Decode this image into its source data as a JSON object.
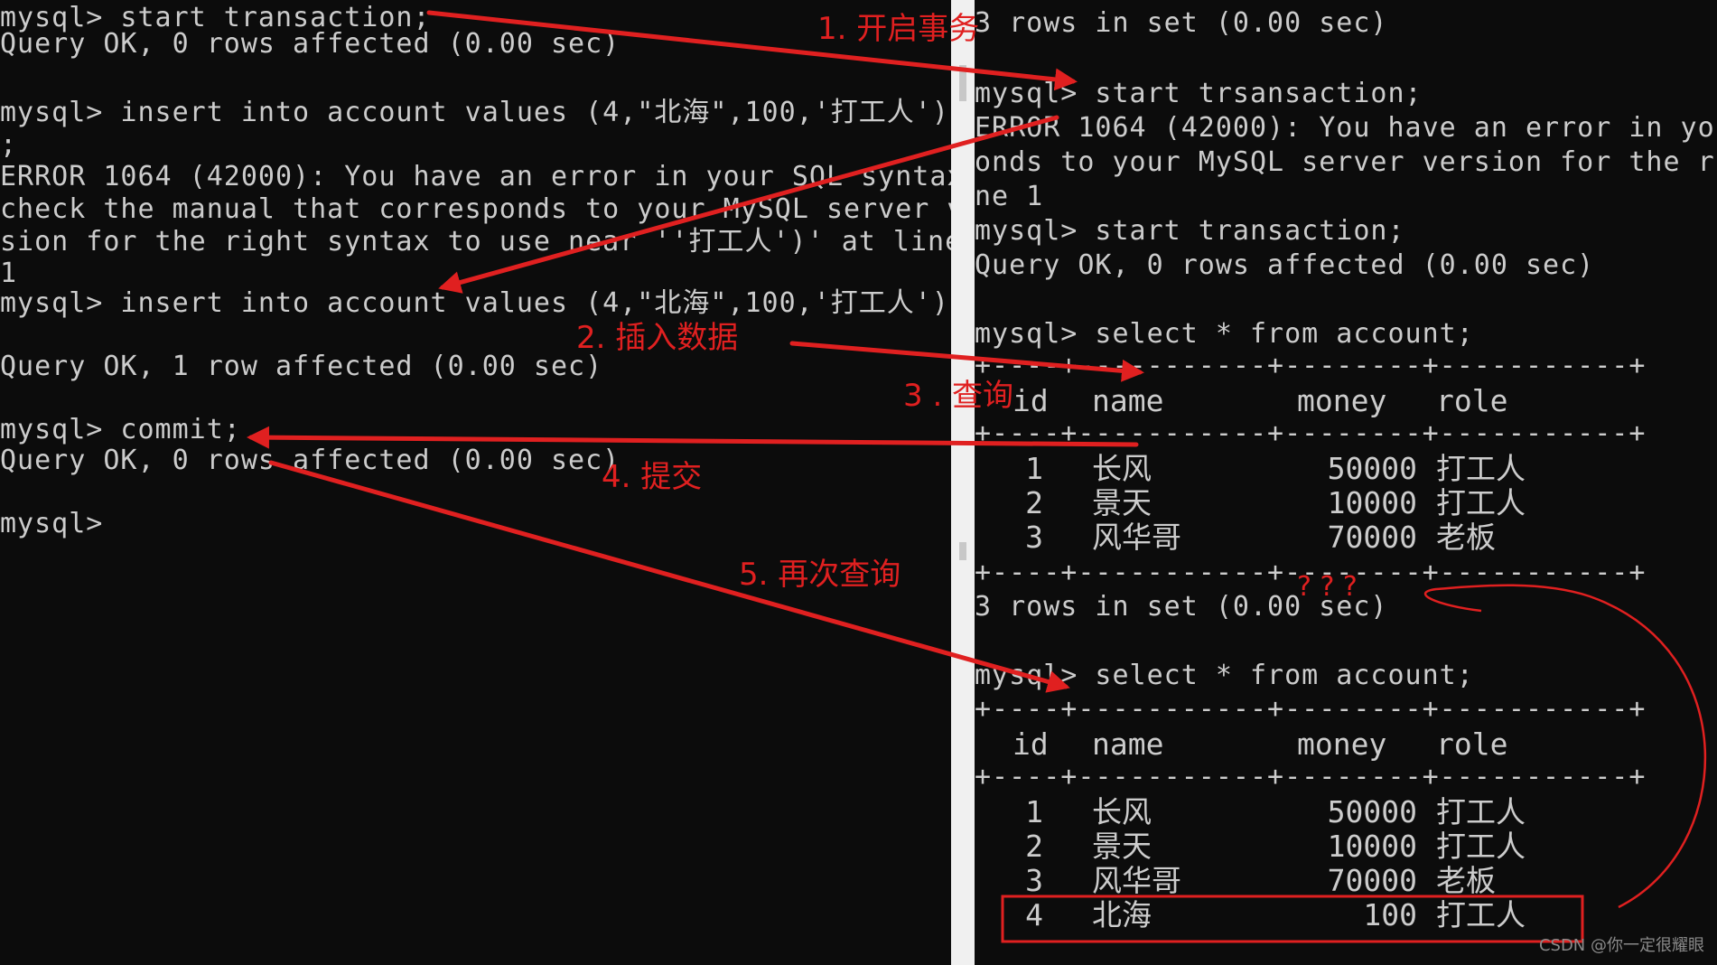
{
  "left_terminal": {
    "lines": [
      "mysql> start transaction;",
      "Query OK, 0 rows affected (0.00 sec)",
      "",
      "mysql> insert into account values (4,\"北海\",100,'打工人')",
      ";",
      "ERROR 1064 (42000): You have an error in your SQL syntax;",
      "check the manual that corresponds to your MySQL server ver",
      "sion for the right syntax to use near ''打工人')' at line",
      "1",
      "mysql> insert into account values (4,\"北海\",100,'打工人');",
      "",
      "Query OK, 1 row affected (0.00 sec)",
      "",
      "mysql> commit;",
      "Query OK, 0 rows affected (0.00 sec)",
      "",
      "mysql>"
    ]
  },
  "right_terminal": {
    "lines": [
      "3 rows in set (0.00 sec)",
      "",
      "mysql> start trsansaction;",
      "ERROR 1064 (42000): You have an error in yo",
      "onds to your MySQL server version for the r",
      "ne 1",
      "mysql> start transaction;",
      "Query OK, 0 rows affected (0.00 sec)",
      "",
      "mysql> select * from account;"
    ],
    "table_border": "+----+-----------+--------+-----------+",
    "headers": [
      "id",
      "name",
      "money",
      "role"
    ],
    "table1_rows": [
      [
        "1",
        "长风",
        "50000",
        "打工人"
      ],
      [
        "2",
        "景天",
        "10000",
        "打工人"
      ],
      [
        "3",
        "风华哥",
        "70000",
        "老板"
      ]
    ],
    "result1": "3 rows in set (0.00 sec)",
    "select2": "mysql> select * from account;",
    "table2_rows": [
      [
        "1",
        "长风",
        "50000",
        "打工人"
      ],
      [
        "2",
        "景天",
        "10000",
        "打工人"
      ],
      [
        "3",
        "风华哥",
        "70000",
        "老板"
      ],
      [
        "4",
        "北海",
        "100",
        "打工人"
      ]
    ]
  },
  "annotations": {
    "step1": "1. 开启事务",
    "step2": "2. 插入数据",
    "step3": "3 . 查询",
    "step4": "4. 提交",
    "step5": "5. 再次查询",
    "question": "? ? ?"
  },
  "watermark": "CSDN @你一定很耀眼",
  "colors": {
    "terminal_bg": "#0c0c0c",
    "terminal_text": "#cccccc",
    "annotation_red": "#e02020",
    "divider": "#f0f0f0"
  }
}
